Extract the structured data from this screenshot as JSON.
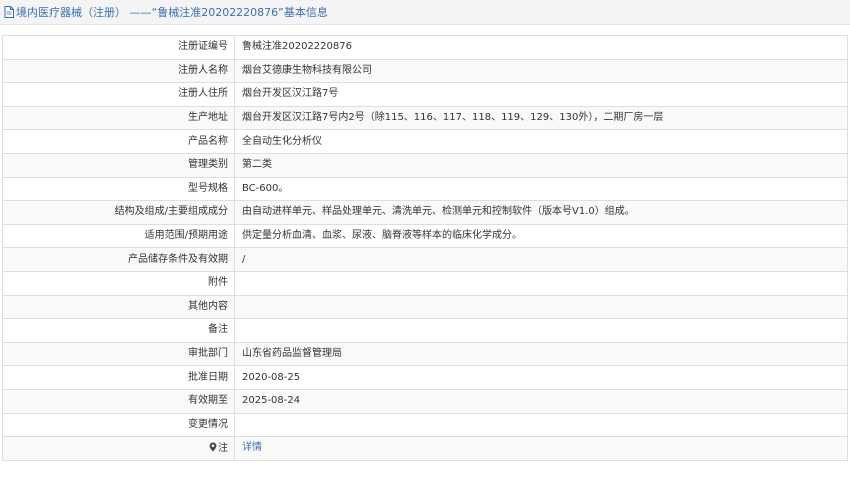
{
  "header": {
    "title": "境内医疗器械（注册） ——“鲁械注准20202220876”基本信息",
    "icon": "document-icon"
  },
  "rows": [
    {
      "key": "reg-number",
      "label": "注册证编号",
      "value": "鲁械注准20202220876"
    },
    {
      "key": "registrant-name",
      "label": "注册人名称",
      "value": "烟台艾德康生物科技有限公司"
    },
    {
      "key": "registrant-address",
      "label": "注册人住所",
      "value": "烟台开发区汉江路7号"
    },
    {
      "key": "production-address",
      "label": "生产地址",
      "value": "烟台开发区汉江路7号内2号（除115、116、117、118、119、129、130外），二期厂房一层"
    },
    {
      "key": "product-name",
      "label": "产品名称",
      "value": "全自动生化分析仪"
    },
    {
      "key": "management-category",
      "label": "管理类别",
      "value": "第二类"
    },
    {
      "key": "model-spec",
      "label": "型号规格",
      "value": "BC-600。"
    },
    {
      "key": "structure-composition",
      "label": "结构及组成/主要组成成分",
      "value": "由自动进样单元、样品处理单元、清洗单元、检测单元和控制软件（版本号V1.0）组成。"
    },
    {
      "key": "intended-use",
      "label": "适用范围/预期用途",
      "value": "供定量分析血清、血浆、尿液、脑脊液等样本的临床化学成分。"
    },
    {
      "key": "storage-validity",
      "label": "产品储存条件及有效期",
      "value": "/"
    },
    {
      "key": "attachment",
      "label": "附件",
      "value": ""
    },
    {
      "key": "other-content",
      "label": "其他内容",
      "value": ""
    },
    {
      "key": "remarks",
      "label": "备注",
      "value": ""
    },
    {
      "key": "approval-department",
      "label": "审批部门",
      "value": "山东省药品监督管理局"
    },
    {
      "key": "approval-date",
      "label": "批准日期",
      "value": "2020-08-25"
    },
    {
      "key": "valid-until",
      "label": "有效期至",
      "value": "2025-08-24"
    },
    {
      "key": "change-status",
      "label": "变更情况",
      "value": ""
    }
  ],
  "note": {
    "label": "注",
    "link_text": "详情",
    "icon": "location-pin-icon"
  },
  "colors": {
    "link": "#3a6fb4",
    "text": "#333333",
    "border": "#dedede",
    "header_bg": "#f4f4f4"
  }
}
